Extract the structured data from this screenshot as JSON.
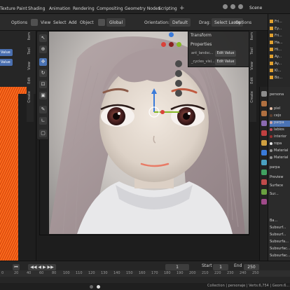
{
  "topbar": {
    "menus": [
      "Texture Paint",
      "Shading",
      "Animation",
      "Rendering",
      "Compositing",
      "Geometry Nodes",
      "Scripting"
    ],
    "add_tab": "+",
    "scene_label": "Scene"
  },
  "header": {
    "options_left": "Options",
    "view": "View",
    "select": "Select",
    "add": "Add",
    "object": "Object",
    "global": "Global",
    "orientation_label": "Orientation:",
    "orientation_value": "Default",
    "drag_label": "Drag:",
    "drag_value": "Select Lasso",
    "options_right": "Options"
  },
  "left_panel": {
    "value_button_1": "Value",
    "value_button_2": "Value",
    "label_1": "Value",
    "label_2": "Value"
  },
  "side_tabs_left": [
    "Item",
    "Tool",
    "View",
    "Edit",
    "Create"
  ],
  "side_tabs_right": [
    "Item",
    "Tool",
    "View",
    "Edit",
    "Create"
  ],
  "floating_panel": {
    "transform": "Transform",
    "properties": "Properties",
    "row_1_label": "ant_landsc...",
    "row_1_button": "Edit Value",
    "row_2_label": "_cycles_visi...",
    "row_2_button": "Edit Value"
  },
  "outliner": {
    "rows": [
      "Fri...",
      "Ey...",
      "Fri...",
      "Ha...",
      "Hi...",
      "Ay...",
      "Ay...",
      "Kl...",
      "Bo..."
    ]
  },
  "properties_panel": {
    "search": "persona",
    "materials": [
      "piel",
      "cejo",
      "parpa",
      "labios",
      "interior",
      "ropa",
      "Material",
      "Material"
    ],
    "material_colors": [
      "#e8c0a8",
      "#604030",
      "#d4a4a0",
      "#c44a5a",
      "#9a3030",
      "#e8e8e8",
      "#909090",
      "#909090"
    ],
    "selected_material": "parpa",
    "sections": [
      "Preview",
      "Surface"
    ],
    "surface_rows": [
      "Sur...",
      "Ba...",
      "Subsurf...",
      "Subsurf...",
      "Subsurfa...",
      "Subsurfac...",
      "Subsurfac..."
    ]
  },
  "timeline": {
    "current_frame": "1",
    "start_label": "Start",
    "start_value": "1",
    "end_label": "End",
    "end_value": "250",
    "ruler": [
      "0",
      "20",
      "40",
      "60",
      "80",
      "100",
      "110",
      "120",
      "130",
      "140",
      "150",
      "160",
      "170",
      "180",
      "190",
      "200",
      "210",
      "220",
      "230",
      "240",
      "250"
    ]
  },
  "statusbar": {
    "text": "Collection | personaje | Verts:6,754 | Geom:6..."
  },
  "colors": {
    "accent": "#4a73b5",
    "hair_orange": "#ff5a12",
    "gizmo_x": "#d9423a",
    "gizmo_y": "#86b827",
    "gizmo_z": "#3a7ad9"
  }
}
